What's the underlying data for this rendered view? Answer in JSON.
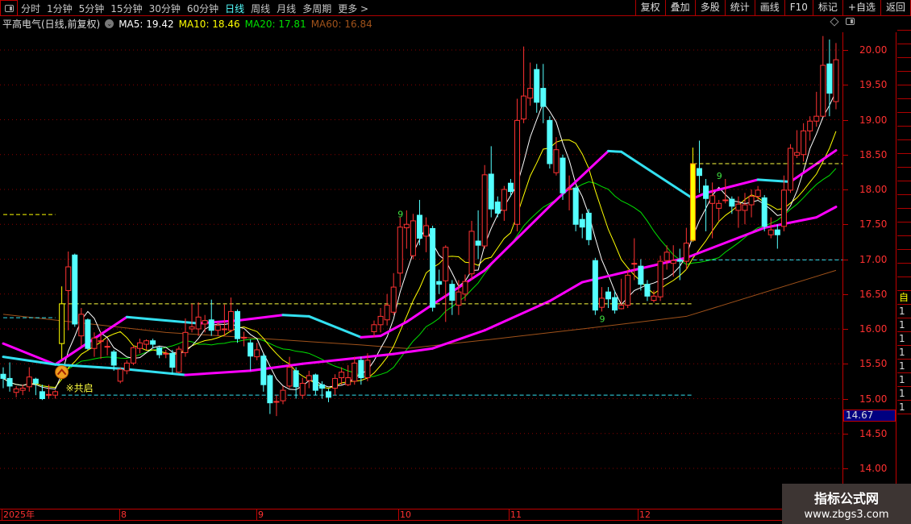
{
  "topbar": {
    "periods": [
      "分时",
      "1分钟",
      "5分钟",
      "15分钟",
      "30分钟",
      "60分钟",
      "日线",
      "周线",
      "月线",
      "多周期",
      "更多 >"
    ],
    "active_period": "日线",
    "tools": [
      "复权",
      "叠加",
      "多股",
      "统计",
      "画线",
      "F10",
      "标记",
      "+自选",
      "返回"
    ]
  },
  "info": {
    "title": "平高电气(日线,前复权)",
    "ma5": "MA5: 19.42",
    "ma10": "MA10: 18.46",
    "ma20": "MA20: 17.81",
    "ma60": "MA60: 16.84"
  },
  "colors": {
    "up": "#ff3232",
    "down": "#54ffff",
    "ma5": "#ffffff",
    "ma10": "#ffff00",
    "ma20": "#00e000",
    "ma60": "#a0521a",
    "band_up": "#ff00ff",
    "band_down": "#33e0f0",
    "grid": "#8a0000"
  },
  "axis": {
    "labels": [
      "20.00",
      "19.50",
      "19.00",
      "18.50",
      "18.00",
      "17.50",
      "17.00",
      "16.50",
      "16.00",
      "15.50",
      "15.00",
      "14.50",
      "14.00"
    ],
    "cursor_price": "14.67"
  },
  "dates": [
    "2025年",
    "8",
    "9",
    "10",
    "11",
    "12"
  ],
  "strip": [
    "自",
    "1",
    "1",
    "1",
    "1",
    "1",
    "1",
    "1",
    "1"
  ],
  "watermark": {
    "line1": "指标公式网",
    "line2": "www.zbgs3.com"
  },
  "chart_data": {
    "type": "candlestick",
    "ylim": [
      13.75,
      20.2
    ],
    "candles_ochl": [
      [
        15.35,
        15.29,
        15.45,
        15.15
      ],
      [
        15.29,
        15.18,
        15.52,
        15.1
      ],
      [
        15.09,
        15.14,
        15.18,
        15.02
      ],
      [
        15.12,
        15.15,
        15.2,
        15.05
      ],
      [
        15.17,
        15.31,
        15.45,
        15.1
      ],
      [
        15.28,
        15.22,
        15.3,
        15.05
      ],
      [
        15.1,
        15.0,
        15.2,
        14.98
      ],
      [
        15.06,
        15.06,
        15.2,
        15.0
      ],
      [
        15.05,
        15.1,
        15.12,
        15.0
      ],
      [
        15.79,
        16.36,
        16.61,
        15.57
      ],
      [
        16.55,
        16.89,
        17.11,
        15.98
      ],
      [
        17.06,
        16.07,
        17.08,
        16.03
      ],
      [
        15.9,
        16.21,
        16.3,
        15.75
      ],
      [
        16.13,
        15.72,
        16.15,
        15.7
      ],
      [
        15.72,
        15.87,
        15.95,
        15.6
      ],
      [
        15.83,
        15.83,
        15.96,
        15.57
      ],
      [
        15.75,
        15.75,
        15.85,
        15.62
      ],
      [
        15.67,
        15.48,
        15.7,
        15.4
      ],
      [
        15.25,
        15.42,
        15.45,
        15.22
      ],
      [
        15.4,
        15.51,
        15.55,
        15.35
      ],
      [
        15.51,
        15.73,
        15.76,
        15.48
      ],
      [
        15.72,
        15.8,
        15.86,
        15.65
      ],
      [
        15.78,
        15.83,
        15.85,
        15.7
      ],
      [
        15.83,
        15.78,
        15.86,
        15.72
      ],
      [
        15.73,
        15.63,
        15.75,
        15.58
      ],
      [
        15.65,
        15.65,
        15.7,
        15.58
      ],
      [
        15.65,
        15.45,
        15.7,
        15.35
      ],
      [
        15.38,
        15.71,
        15.75,
        15.36
      ],
      [
        15.66,
        15.95,
        16.15,
        15.6
      ],
      [
        16.0,
        16.03,
        16.36,
        15.95
      ],
      [
        16.0,
        16.17,
        16.38,
        15.9
      ],
      [
        16.07,
        16.12,
        16.2,
        15.95
      ],
      [
        16.13,
        15.98,
        16.42,
        15.9
      ],
      [
        15.98,
        16.05,
        16.1,
        15.9
      ],
      [
        16.0,
        16.0,
        16.35,
        15.9
      ],
      [
        15.98,
        16.25,
        16.45,
        15.95
      ],
      [
        16.25,
        15.86,
        16.28,
        15.8
      ],
      [
        15.88,
        15.88,
        15.96,
        15.75
      ],
      [
        15.8,
        15.61,
        15.85,
        15.4
      ],
      [
        15.6,
        15.7,
        15.8,
        15.55
      ],
      [
        15.61,
        15.2,
        15.65,
        15.1
      ],
      [
        15.33,
        14.94,
        15.35,
        14.78
      ],
      [
        14.96,
        14.96,
        15.05,
        14.75
      ],
      [
        14.97,
        15.12,
        15.18,
        14.92
      ],
      [
        15.18,
        15.45,
        15.6,
        15.15
      ],
      [
        15.4,
        15.17,
        15.45,
        15.0
      ],
      [
        15.05,
        15.22,
        15.3,
        15.0
      ],
      [
        15.26,
        15.33,
        15.4,
        15.15
      ],
      [
        15.34,
        15.12,
        15.36,
        15.05
      ],
      [
        15.2,
        15.15,
        15.25,
        15.0
      ],
      [
        15.1,
        15.02,
        15.14,
        14.95
      ],
      [
        15.15,
        15.29,
        15.35,
        15.05
      ],
      [
        15.3,
        15.38,
        15.45,
        15.2
      ],
      [
        15.2,
        15.3,
        15.48,
        15.18
      ],
      [
        15.25,
        15.51,
        15.6,
        15.2
      ],
      [
        15.55,
        15.3,
        15.6,
        15.2
      ],
      [
        15.3,
        15.55,
        15.65,
        15.25
      ],
      [
        15.96,
        16.06,
        16.12,
        15.88
      ],
      [
        16.06,
        16.18,
        16.3,
        15.95
      ],
      [
        16.13,
        16.34,
        16.5,
        16.05
      ],
      [
        16.24,
        16.6,
        16.8,
        16.2
      ],
      [
        16.8,
        17.46,
        17.6,
        16.6
      ],
      [
        17.45,
        17.5,
        17.7,
        17.15
      ],
      [
        17.05,
        17.55,
        17.65,
        17.0
      ],
      [
        17.63,
        17.3,
        17.85,
        17.2
      ],
      [
        17.33,
        17.48,
        17.6,
        17.1
      ],
      [
        17.44,
        16.31,
        17.48,
        16.25
      ],
      [
        16.68,
        16.64,
        16.85,
        16.5
      ],
      [
        16.69,
        17.17,
        17.2,
        16.1
      ],
      [
        16.64,
        16.41,
        16.7,
        16.2
      ],
      [
        16.34,
        16.53,
        16.7,
        16.2
      ],
      [
        16.5,
        16.68,
        16.78,
        16.4
      ],
      [
        16.79,
        17.4,
        17.55,
        16.7
      ],
      [
        17.26,
        17.2,
        17.7,
        17.0
      ],
      [
        17.19,
        18.21,
        18.35,
        17.15
      ],
      [
        18.22,
        17.72,
        18.62,
        17.6
      ],
      [
        17.82,
        17.66,
        17.9,
        17.6
      ],
      [
        17.7,
        18.0,
        18.05,
        17.55
      ],
      [
        18.09,
        17.97,
        18.15,
        17.9
      ],
      [
        17.5,
        18.99,
        19.3,
        17.4
      ],
      [
        19.01,
        19.34,
        20.05,
        18.95
      ],
      [
        19.31,
        19.45,
        19.82,
        19.2
      ],
      [
        19.72,
        19.25,
        19.8,
        19.1
      ],
      [
        19.45,
        19.19,
        19.8,
        18.95
      ],
      [
        18.99,
        18.37,
        19.05,
        18.3
      ],
      [
        18.24,
        18.57,
        18.75,
        18.2
      ],
      [
        18.45,
        17.95,
        18.5,
        17.85
      ],
      [
        18.01,
        18.01,
        18.2,
        17.7
      ],
      [
        18.02,
        17.5,
        18.05,
        17.4
      ],
      [
        17.57,
        17.46,
        17.65,
        17.3
      ],
      [
        17.66,
        17.28,
        17.72,
        17.2
      ],
      [
        16.98,
        16.27,
        17.02,
        16.2
      ],
      [
        16.31,
        16.44,
        16.6,
        16.25
      ],
      [
        16.53,
        16.43,
        16.6,
        16.3
      ],
      [
        16.45,
        16.27,
        16.55,
        16.22
      ],
      [
        16.29,
        16.34,
        16.72,
        16.28
      ],
      [
        16.34,
        16.77,
        16.85,
        16.3
      ],
      [
        16.94,
        16.94,
        17.3,
        16.7
      ],
      [
        16.9,
        16.64,
        17.0,
        16.55
      ],
      [
        16.64,
        16.47,
        16.7,
        16.4
      ],
      [
        16.41,
        16.47,
        16.55,
        16.38
      ],
      [
        16.46,
        16.97,
        17.05,
        16.4
      ],
      [
        16.98,
        17.1,
        17.2,
        16.85
      ],
      [
        16.94,
        16.98,
        17.2,
        16.75
      ],
      [
        16.99,
        16.97,
        17.15,
        16.7
      ],
      [
        16.97,
        17.23,
        17.45,
        16.85
      ],
      [
        17.27,
        18.37,
        18.6,
        17.25
      ],
      [
        18.3,
        18.2,
        18.7,
        17.95
      ],
      [
        18.05,
        17.87,
        18.15,
        17.4
      ],
      [
        17.8,
        17.91,
        18.1,
        17.3
      ],
      [
        17.73,
        17.8,
        17.85,
        17.55
      ],
      [
        17.85,
        17.85,
        18.15,
        17.8
      ],
      [
        17.86,
        17.76,
        17.9,
        17.65
      ],
      [
        17.7,
        17.79,
        17.9,
        17.45
      ],
      [
        17.7,
        17.78,
        17.95,
        17.5
      ],
      [
        17.78,
        17.9,
        18.0,
        17.6
      ],
      [
        17.9,
        17.99,
        18.05,
        17.85
      ],
      [
        17.88,
        17.47,
        17.92,
        17.4
      ],
      [
        17.35,
        17.42,
        17.6,
        17.3
      ],
      [
        17.42,
        17.35,
        17.5,
        17.15
      ],
      [
        17.47,
        17.99,
        18.2,
        17.4
      ],
      [
        17.99,
        18.59,
        18.65,
        17.95
      ],
      [
        18.49,
        18.53,
        18.85,
        18.45
      ],
      [
        18.5,
        18.84,
        18.95,
        18.4
      ],
      [
        18.84,
        18.98,
        19.05,
        18.7
      ],
      [
        18.98,
        19.05,
        19.4,
        18.9
      ],
      [
        19.05,
        19.78,
        20.2,
        19.05
      ],
      [
        19.8,
        19.38,
        20.15,
        19.05
      ],
      [
        19.26,
        19.86,
        20.1,
        19.15
      ]
    ],
    "highlighted_candles": [
      {
        "index": 9,
        "style": "hollow"
      },
      {
        "index": 106,
        "style": "filled"
      }
    ],
    "band_upper": [
      [
        0,
        15.79
      ],
      [
        8,
        15.49
      ],
      [
        19,
        16.17
      ],
      [
        30,
        16.08
      ],
      [
        36,
        16.12
      ],
      [
        43,
        16.2
      ],
      [
        47,
        16.18
      ],
      [
        55,
        15.88
      ],
      [
        58,
        15.9
      ],
      [
        62,
        16.1
      ],
      [
        66,
        16.35
      ],
      [
        74,
        16.84
      ],
      [
        84,
        17.76
      ],
      [
        93,
        18.55
      ],
      [
        95,
        18.54
      ],
      [
        106,
        17.87
      ],
      [
        108,
        17.95
      ],
      [
        116,
        18.14
      ],
      [
        121,
        18.11
      ],
      [
        128,
        18.56
      ]
    ],
    "band_lower": [
      [
        0,
        15.6
      ],
      [
        8,
        15.49
      ],
      [
        18,
        15.43
      ],
      [
        28,
        15.34
      ],
      [
        38,
        15.4
      ],
      [
        46,
        15.5
      ],
      [
        54,
        15.58
      ],
      [
        60,
        15.64
      ],
      [
        66,
        15.72
      ],
      [
        74,
        15.98
      ],
      [
        84,
        16.4
      ],
      [
        89,
        16.67
      ],
      [
        105,
        17.02
      ],
      [
        117,
        17.45
      ],
      [
        125,
        17.6
      ],
      [
        128,
        17.75
      ]
    ],
    "ma60": [
      [
        0,
        16.21
      ],
      [
        25,
        15.95
      ],
      [
        55,
        15.77
      ],
      [
        62,
        15.72
      ],
      [
        75,
        15.85
      ],
      [
        89,
        16.0
      ],
      [
        105,
        16.18
      ],
      [
        128,
        16.84
      ]
    ],
    "levels": [
      {
        "price": 17.64,
        "from": 0,
        "to": 8,
        "color": "#ffff00"
      },
      {
        "price": 16.16,
        "from": 0,
        "to": 8,
        "color": "#33e0f0"
      },
      {
        "price": 16.36,
        "from": 9,
        "to": 106,
        "color": "#ffff40"
      },
      {
        "price": 15.05,
        "from": 9,
        "to": 106,
        "color": "#33e0f0"
      },
      {
        "price": 18.37,
        "from": 106,
        "to": 129,
        "color": "#ffff40"
      },
      {
        "price": 16.99,
        "from": 106,
        "to": 129,
        "color": "#33e0f0"
      }
    ],
    "markers": [
      {
        "index": 61,
        "price": 17.6,
        "text": "9"
      },
      {
        "index": 92,
        "price": 16.1,
        "text": "9"
      },
      {
        "index": 110,
        "price": 18.15,
        "text": "9"
      }
    ],
    "signal": {
      "index": 9,
      "price": 15.38,
      "text": "※共启"
    }
  }
}
